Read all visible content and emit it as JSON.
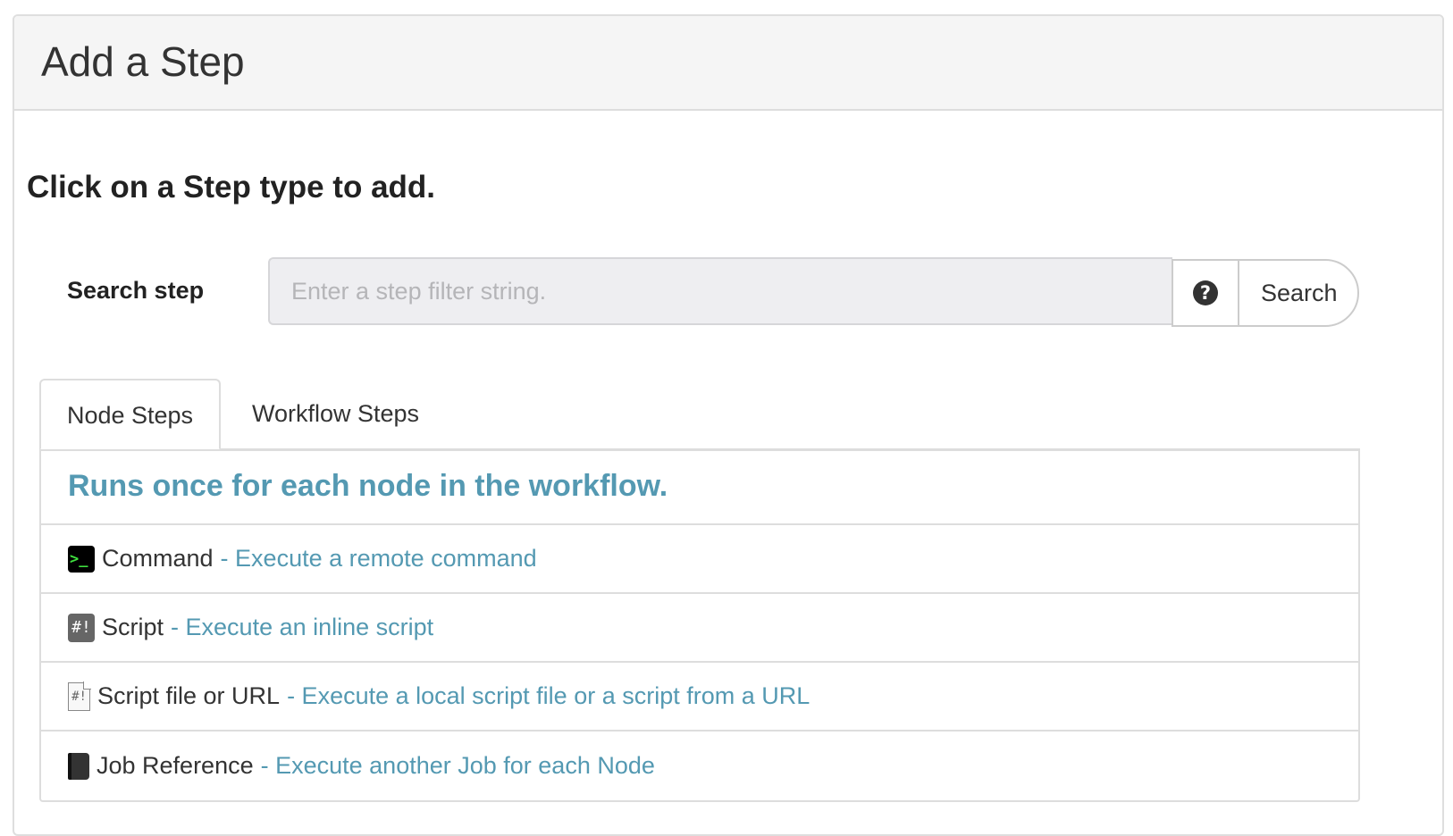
{
  "header": {
    "title": "Add a Step"
  },
  "instruction": "Click on a Step type to add.",
  "search": {
    "label": "Search step",
    "placeholder": "Enter a step filter string.",
    "help_icon": "question-circle-icon",
    "button_label": "Search"
  },
  "tabs": [
    {
      "label": "Node Steps",
      "active": true
    },
    {
      "label": "Workflow Steps",
      "active": false
    }
  ],
  "list": {
    "heading": "Runs once for each node in the workflow.",
    "items": [
      {
        "icon": "terminal-icon",
        "name": "Command",
        "description": "- Execute a remote command"
      },
      {
        "icon": "script-icon",
        "name": "Script",
        "description": "- Execute an inline script"
      },
      {
        "icon": "script-file-icon",
        "name": "Script file or URL",
        "description": "- Execute a local script file or a script from a URL"
      },
      {
        "icon": "book-icon",
        "name": "Job Reference",
        "description": "- Execute another Job for each Node"
      }
    ]
  },
  "colors": {
    "link": "#5499b2",
    "header_bg": "#f5f5f5",
    "input_bg": "#eeeef1",
    "terminal_green": "#3fe03f"
  }
}
